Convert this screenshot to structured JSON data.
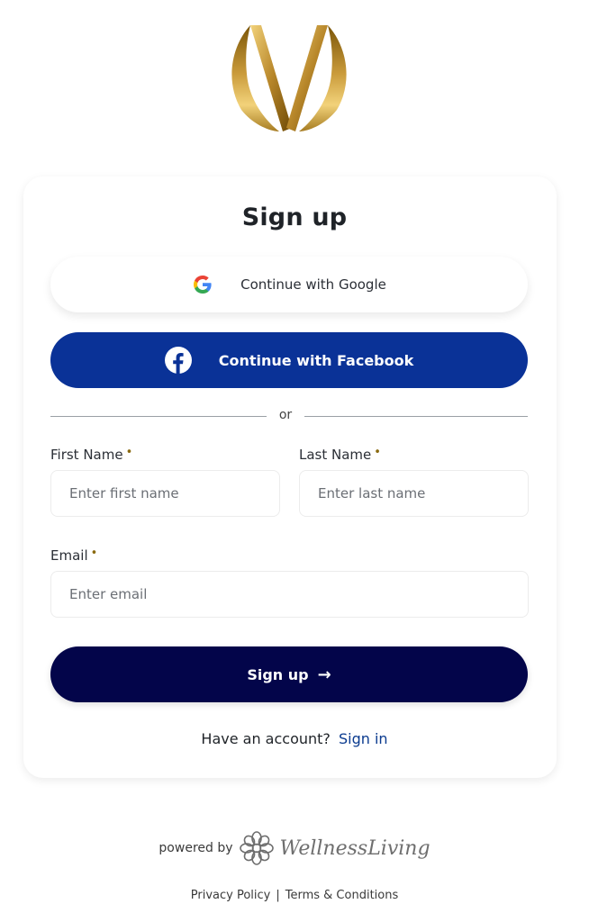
{
  "brand": {
    "logo_icon": "gold-m-logo-icon",
    "gold_light": "#f2d27a",
    "gold_dark": "#7a5508"
  },
  "form": {
    "title": "Sign up",
    "google_label": "Continue with Google",
    "facebook_label": "Continue with Facebook",
    "facebook_color": "#0a3297",
    "divider_text": "or",
    "first_name": {
      "label": "First Name",
      "required_mark": "•",
      "placeholder": "Enter first name",
      "value": ""
    },
    "last_name": {
      "label": "Last Name",
      "required_mark": "•",
      "placeholder": "Enter last name",
      "value": ""
    },
    "email": {
      "label": "Email",
      "required_mark": "•",
      "placeholder": "Enter email",
      "value": ""
    },
    "submit_label": "Sign up",
    "submit_arrow": "→",
    "submit_color": "#03054a",
    "account_prompt": "Have an account?",
    "signin_label": "Sign in"
  },
  "footer": {
    "powered_by": "powered by",
    "provider_name": "WellnessLiving",
    "provider_icon": "wellnessliving-flower-icon",
    "privacy": "Privacy Policy",
    "separator": "|",
    "terms": "Terms & Conditions"
  }
}
